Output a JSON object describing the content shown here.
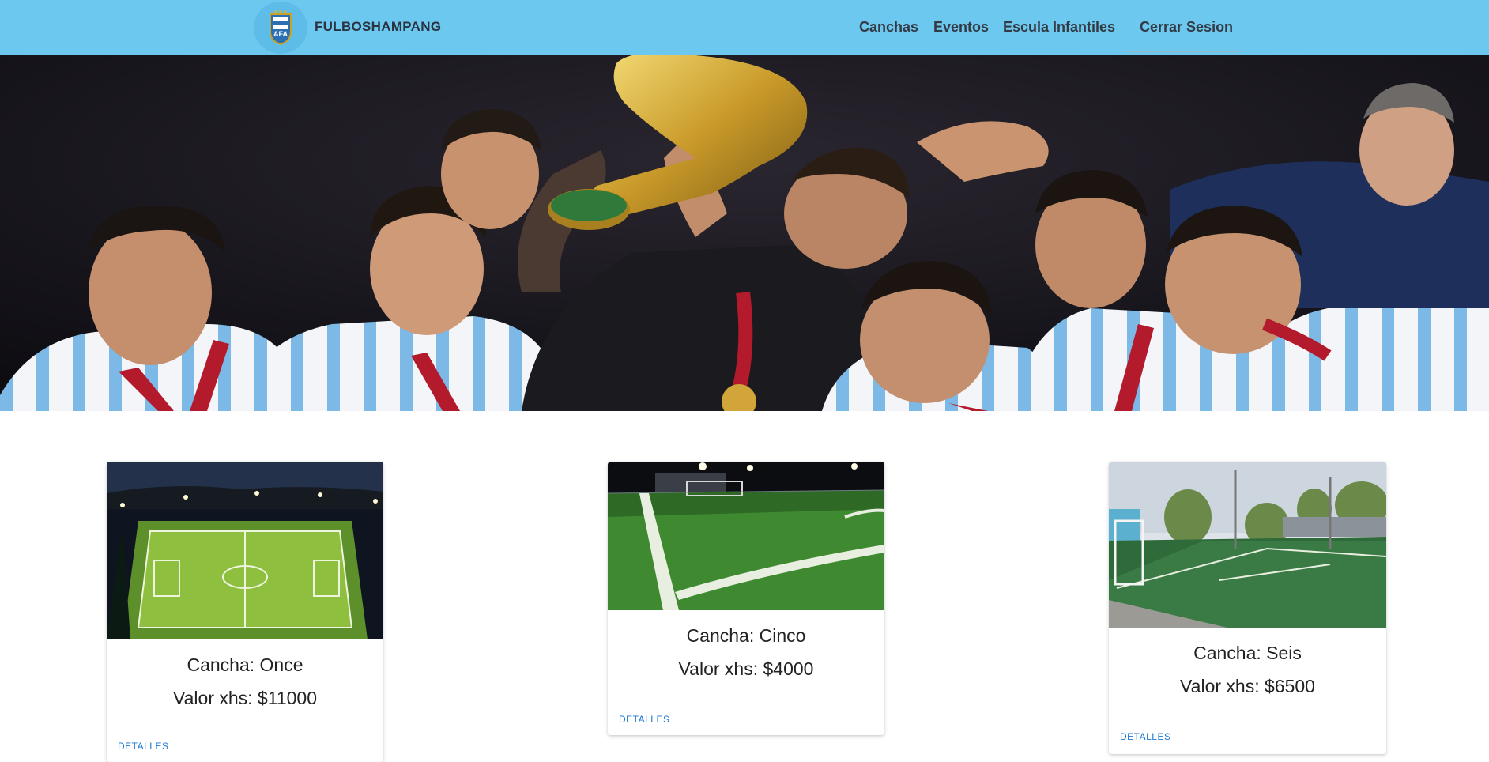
{
  "header": {
    "brand": "FULBOSHAMPANG",
    "logo_icon": "afa-crest-icon",
    "nav": {
      "canchas": "Canchas",
      "eventos": "Eventos",
      "escuela": "Escula Infantiles",
      "logout": "Cerrar Sesion"
    },
    "bg_color": "#6cc8ef"
  },
  "hero": {
    "image": "argentina-team-celebration-with-trophy"
  },
  "cards": [
    {
      "title": "Cancha: Once",
      "price": "Valor xhs: $11000",
      "button": "DETALLES",
      "image": "night-football-field"
    },
    {
      "title": "Cancha: Cinco",
      "price": "Valor xhs: $4000",
      "button": "DETALLES",
      "image": "turf-corner-closeup"
    },
    {
      "title": "Cancha: Seis",
      "price": "Valor xhs: $6500",
      "button": "DETALLES",
      "image": "daytime-football-field"
    }
  ],
  "colors": {
    "accent_link": "#1976d2",
    "nav_text": "#333a44"
  }
}
